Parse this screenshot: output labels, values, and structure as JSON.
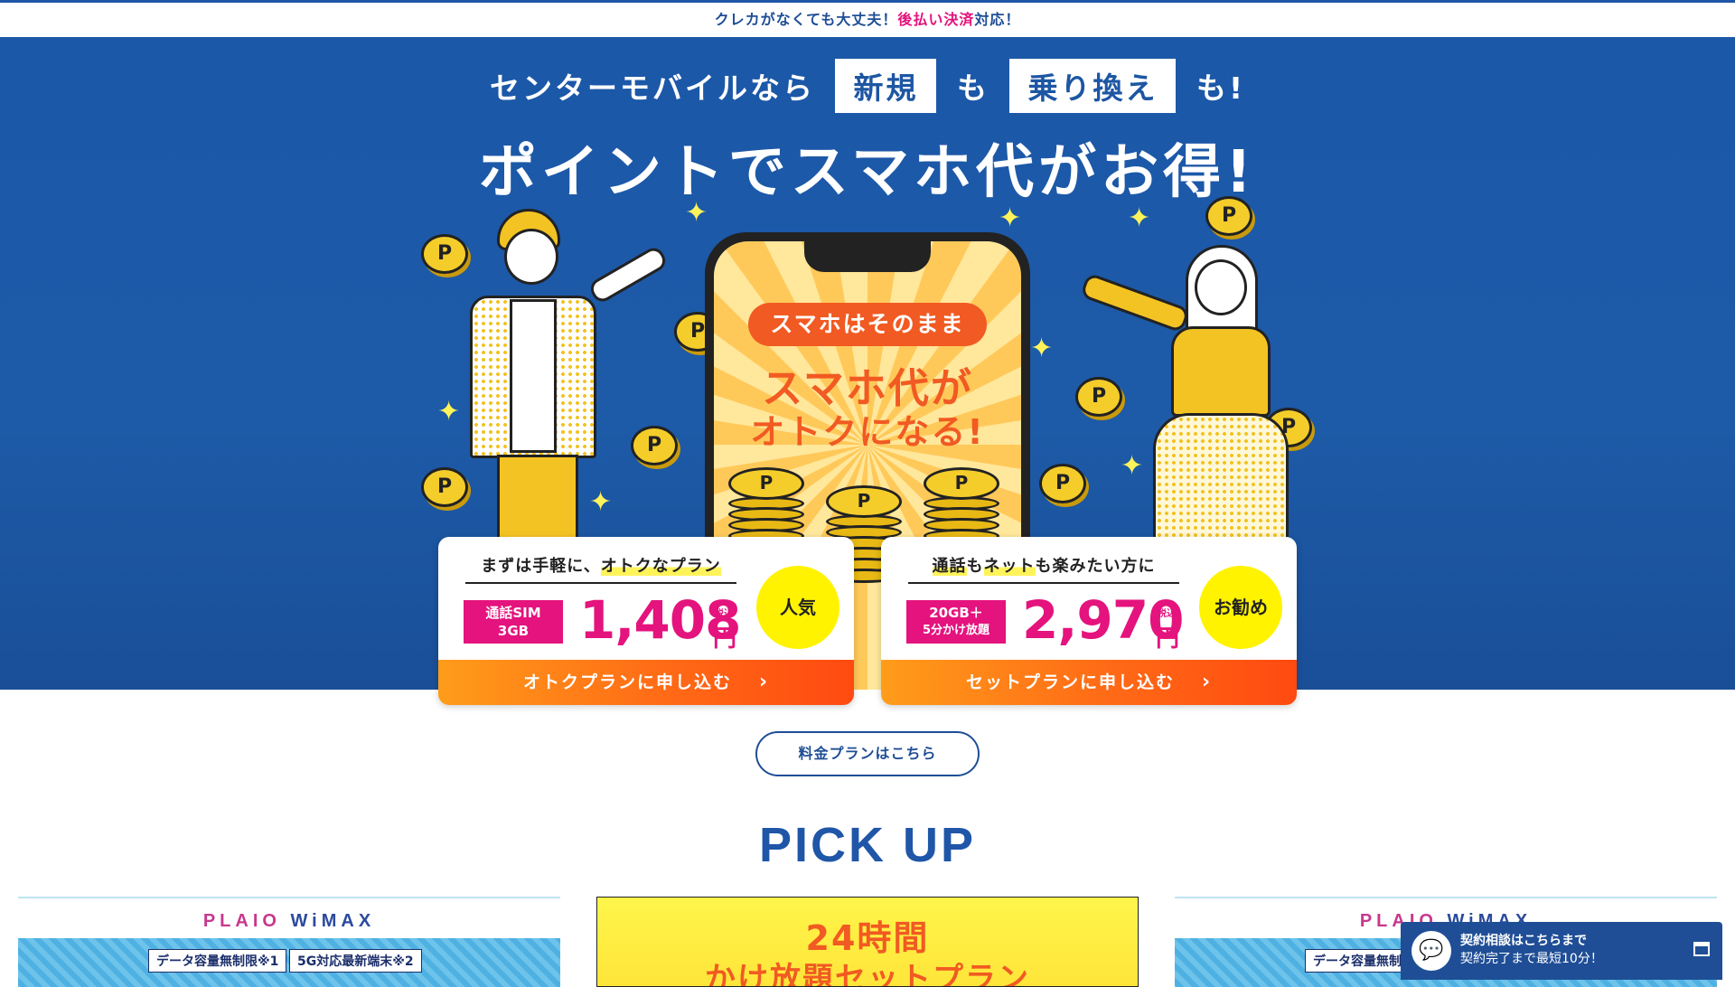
{
  "topbar": {
    "text_before": "クレカがなくても大丈夫！",
    "text_accent": "後払い決済",
    "text_after": "対応！"
  },
  "hero": {
    "line1_a": "センターモバイルなら",
    "line1_box1": "新規",
    "line1_b": "も",
    "line1_box2": "乗り換え",
    "line1_c": "も!",
    "title": "ポイントでスマホ代がお得!",
    "phone_pill": "スマホはそのまま",
    "phone_copy1": "スマホ代が",
    "phone_copy2": "オトクになる!",
    "coin_letter": "P"
  },
  "plans": [
    {
      "heading_a": "まずは手軽に、",
      "heading_hl": "オトクなプラン",
      "badge_line1": "通話SIM",
      "badge_line2": "3GB",
      "price": "1,408",
      "tax": "税込",
      "yen": "円",
      "circle": "人気",
      "button": "オトクプランに申し込む"
    },
    {
      "heading_a": "通話",
      "heading_mid": "も",
      "heading_b": "ネット",
      "heading_c": "も楽みたい方に",
      "badge_line1": "20GB＋",
      "badge_line2": "5分かけ放題",
      "price": "2,970",
      "tax": "税込",
      "yen": "円",
      "circle": "お勧め",
      "button": "セットプランに申し込む"
    }
  ],
  "chevron": "›",
  "plans_link": "料金プランはこちら",
  "pickup": {
    "title": "PICK UP",
    "wimax_logo_a": "PLAIO ",
    "wimax_logo_b": "WiMAX",
    "wimax_tag1": "データ容量無制限※1",
    "wimax_tag2": "5G対応最新端末※2",
    "b24_line1": "24時間",
    "b24_line2": "かけ放題セットプラン"
  },
  "chat": {
    "line1": "契約相談はこちらまで",
    "line2": "契約完了まで最短10分！",
    "icon": "chat-bubble-icon"
  },
  "colors": {
    "brand_blue": "#1f56a8",
    "accent_pink": "#e4137d",
    "accent_orange": "#f15a22",
    "highlight_yellow": "#fff300"
  }
}
